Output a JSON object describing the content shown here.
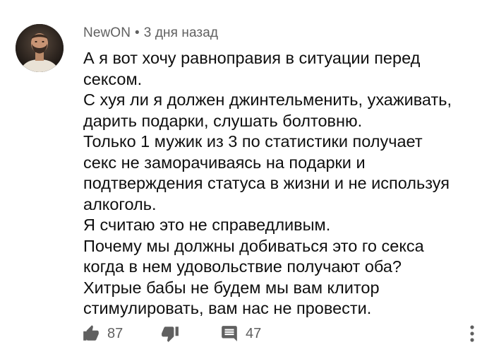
{
  "comment": {
    "author": "NewON",
    "separator": "•",
    "timestamp": "3 дня назад",
    "lines": [
      "А я вот хочу равноправия в ситуации перед",
      "сексом.",
      "С хуя ли я должен джинтельменить, ухаживать,",
      "дарить подарки, слушать болтовню.",
      "Только 1 мужик из 3 по статистики получает",
      "секс не заморачиваясь на подарки и",
      "подтверждения статуса в жизни и не используя",
      "алкоголь.",
      "Я считаю это не справедливым.",
      "Почему мы должны добиваться это го секса",
      "когда в нем удовольствие получают оба?",
      "Хитрые бабы не будем мы вам клитор",
      "стимулировать, вам нас не провести."
    ],
    "likes": "87",
    "replies": "47"
  },
  "icons": {
    "like": "thumbs-up-icon",
    "dislike": "thumbs-down-icon",
    "reply": "comment-icon",
    "more": "more-vertical-icon"
  },
  "colors": {
    "text": "#0f0f0f",
    "secondary": "#606060",
    "icon": "#606060"
  }
}
